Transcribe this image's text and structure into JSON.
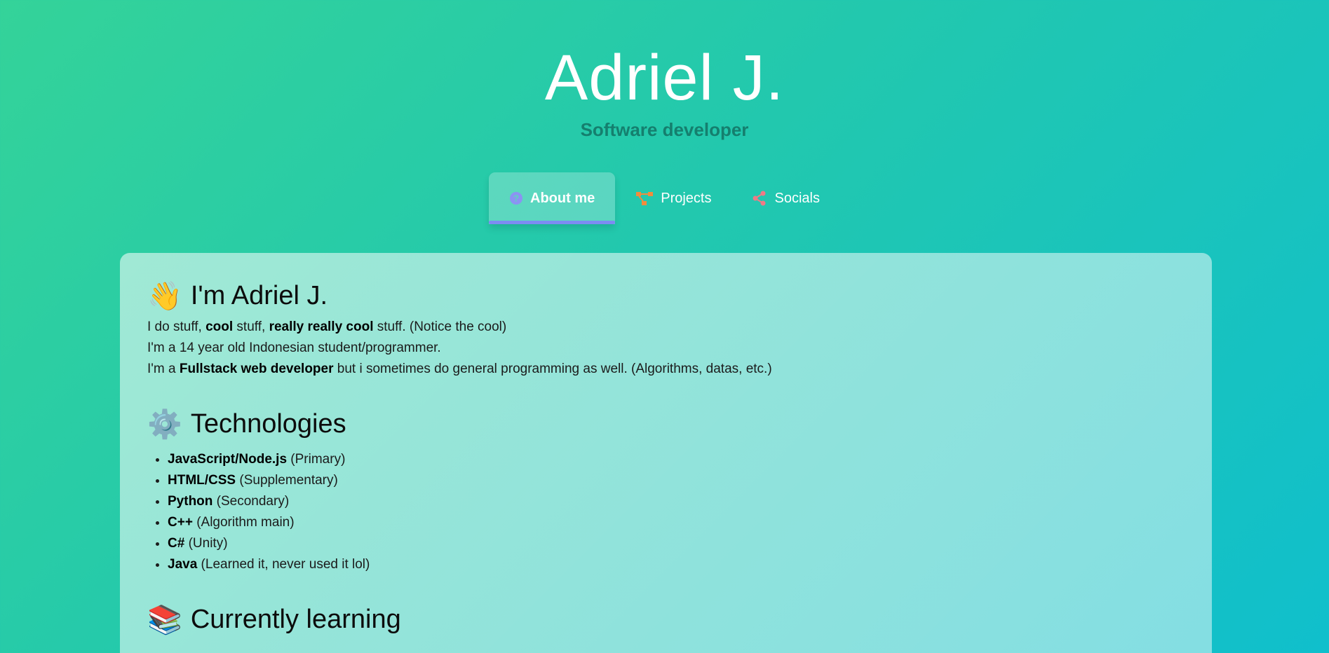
{
  "header": {
    "name": "Adriel J.",
    "role": "Software developer"
  },
  "tabs": [
    {
      "label": "About me",
      "icon": "question-circle-icon",
      "active": true,
      "icon_color": "#8b93f2"
    },
    {
      "label": "Projects",
      "icon": "project-tree-icon",
      "active": false,
      "icon_color": "#f28c3d"
    },
    {
      "label": "Socials",
      "icon": "share-icon",
      "active": false,
      "icon_color": "#f07a86"
    }
  ],
  "about": {
    "emoji": "👋",
    "title": "I'm Adriel J.",
    "line1": {
      "p1": "I do stuff, ",
      "b1": "cool",
      "p2": " stuff, ",
      "b2": "really really cool",
      "p3": " stuff. (Notice the cool)"
    },
    "line2": "I'm a 14 year old Indonesian student/programmer.",
    "line3": {
      "p1": "I'm a ",
      "b1": "Fullstack web developer",
      "p2": " but i sometimes do general programming as well. (Algorithms, datas, etc.)"
    }
  },
  "technologies": {
    "emoji": "⚙️",
    "title": "Technologies",
    "items": [
      {
        "name": "JavaScript/Node.js",
        "note": " (Primary)"
      },
      {
        "name": "HTML/CSS",
        "note": " (Supplementary)"
      },
      {
        "name": "Python",
        "note": " (Secondary)"
      },
      {
        "name": "C++",
        "note": " (Algorithm main)"
      },
      {
        "name": "C#",
        "note": " (Unity)"
      },
      {
        "name": "Java",
        "note": " (Learned it, never used it lol)"
      }
    ]
  },
  "learning": {
    "emoji": "📚",
    "title": "Currently learning"
  },
  "colors": {
    "accent_underline": "#7c8cf2",
    "role_text": "#157f6e"
  }
}
